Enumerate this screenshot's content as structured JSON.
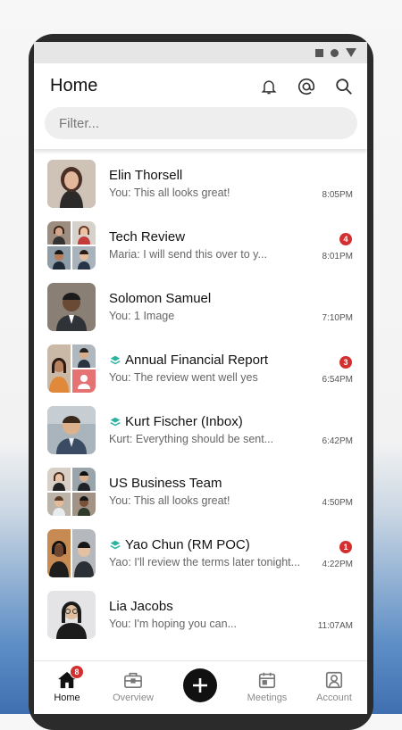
{
  "header": {
    "title": "Home"
  },
  "search": {
    "placeholder": "Filter..."
  },
  "conversations": [
    {
      "name": "Elin Thorsell",
      "preview": "You: This all looks great!",
      "time": "8:05PM",
      "badge": ""
    },
    {
      "name": "Tech Review",
      "preview": "Maria: I will send this over to y...",
      "time": "8:01PM",
      "badge": "4"
    },
    {
      "name": "Solomon Samuel",
      "preview": "You: 1 Image",
      "time": "7:10PM",
      "badge": ""
    },
    {
      "name": "Annual Financial Report",
      "preview": "You: The review went well yes",
      "time": "6:54PM",
      "badge": "3",
      "icon": "stack-icon"
    },
    {
      "name": "Kurt Fischer (Inbox)",
      "preview": "Kurt: Everything should be sent...",
      "time": "6:42PM",
      "badge": "",
      "icon": "stack-icon"
    },
    {
      "name": "US Business Team",
      "preview": "You: This all looks great!",
      "time": "4:50PM",
      "badge": ""
    },
    {
      "name": "Yao Chun (RM POC)",
      "preview": "Yao: I'll review the terms later tonight...",
      "time": "4:22PM",
      "badge": "1",
      "icon": "stack-icon"
    },
    {
      "name": "Lia Jacobs",
      "preview": "You: I'm hoping you can...",
      "time": "11:07AM",
      "badge": ""
    }
  ],
  "tabs": [
    {
      "label": "Home",
      "badge": "8",
      "icon": "home-icon"
    },
    {
      "label": "Overview",
      "icon": "briefcase-icon"
    },
    {
      "label": "",
      "icon": "plus-icon"
    },
    {
      "label": "Meetings",
      "icon": "calendar-icon"
    },
    {
      "label": "Account",
      "icon": "account-icon"
    }
  ],
  "colors": {
    "accent": "#2bb3a0",
    "badge": "#d32f2f",
    "icon_dark": "#111111"
  }
}
